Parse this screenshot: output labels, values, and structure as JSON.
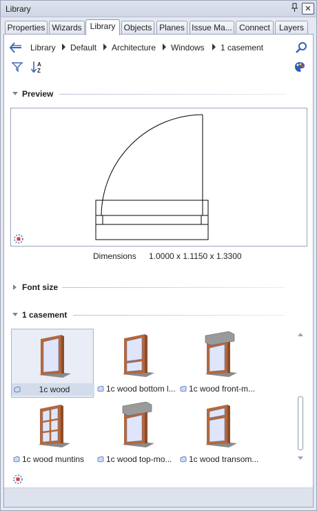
{
  "window": {
    "title": "Library"
  },
  "tabs": [
    {
      "label": "Properties"
    },
    {
      "label": "Wizards"
    },
    {
      "label": "Library"
    },
    {
      "label": "Objects"
    },
    {
      "label": "Planes"
    },
    {
      "label": "Issue Ma..."
    },
    {
      "label": "Connect"
    },
    {
      "label": "Layers"
    }
  ],
  "active_tab": "Library",
  "breadcrumb": [
    "Library",
    "Default",
    "Architecture",
    "Windows",
    "1 casement"
  ],
  "sections": {
    "preview": {
      "label": "Preview",
      "expanded": true
    },
    "font_size": {
      "label": "Font size",
      "expanded": false
    },
    "casement": {
      "label": "1 casement",
      "expanded": true
    }
  },
  "dimensions": {
    "label": "Dimensions",
    "value": "1.0000 x 1.1150 x 1.3300"
  },
  "items": [
    {
      "name": "1c wood",
      "selected": true
    },
    {
      "name": "1c wood bottom l..."
    },
    {
      "name": "1c wood front-m..."
    },
    {
      "name": "1c wood muntins"
    },
    {
      "name": "1c wood top-mo..."
    },
    {
      "name": "1c wood transom..."
    }
  ],
  "icons": [
    "back-arrow-icon",
    "search-icon",
    "filter-icon",
    "sort-az-icon",
    "palette-icon",
    "pin-icon",
    "close-icon",
    "snap-icon"
  ],
  "colors": {
    "frame_wood": "#b5673a",
    "glass": "#dfe6fb",
    "accent": "#4672c4"
  }
}
